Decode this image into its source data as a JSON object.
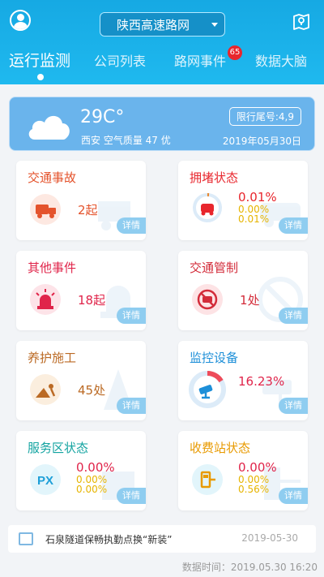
{
  "header": {
    "region": "陕西高速路网",
    "tabs": [
      "运行监测",
      "公司列表",
      "路网事件",
      "数据大脑"
    ],
    "events_badge": "65",
    "colors": {
      "brand": "#1fb9ef",
      "badge": "#e8262d"
    }
  },
  "weather": {
    "temperature": "29C°",
    "city_air": "西安 空气质量 47 优",
    "plate_limit": "限行尾号:4,9",
    "date": "2019年05月30日"
  },
  "cards": {
    "traffic_accident": {
      "title": "交通事故",
      "value": "2起",
      "detail": "详情",
      "icon": "tow-truck-icon",
      "color": "#e4532c"
    },
    "congestion": {
      "title": "拥堵状态",
      "v1": "0.01%",
      "v2": "0.00%",
      "v3": "0.01%",
      "detail": "详情",
      "icon": "congestion-car-icon",
      "color": "#e8262d"
    },
    "other_events": {
      "title": "其他事件",
      "value": "18起",
      "detail": "详情",
      "icon": "alarm-light-icon",
      "color": "#e0244a"
    },
    "traffic_control": {
      "title": "交通管制",
      "value": "1处",
      "detail": "详情",
      "icon": "no-car-icon",
      "color": "#d32c3a"
    },
    "maintenance": {
      "title": "养护施工",
      "value": "45处",
      "detail": "详情",
      "icon": "construction-worker-icon",
      "color": "#bb6a24"
    },
    "cameras": {
      "title": "监控设备",
      "value": "16.23%",
      "detail": "详情",
      "icon": "camera-gauge-icon",
      "color": "#1d8fd8",
      "fill": 0.1623
    },
    "service_area": {
      "title": "服务区状态",
      "v1": "0.00%",
      "v2": "0.00%",
      "v3": "0.00%",
      "detail": "详情",
      "icon": "px-service-icon",
      "color": "#12a3a0"
    },
    "toll_station": {
      "title": "收费站状态",
      "v1": "0.00%",
      "v2": "0.00%",
      "v3": "0.56%",
      "detail": "详情",
      "icon": "toll-booth-icon",
      "color": "#e89a00"
    }
  },
  "news": {
    "text": "石泉隧道保畅执勤点换“新装”",
    "date": "2019-05-30"
  },
  "footer": {
    "data_time": "数据时间：2019.05.30 16:20"
  }
}
